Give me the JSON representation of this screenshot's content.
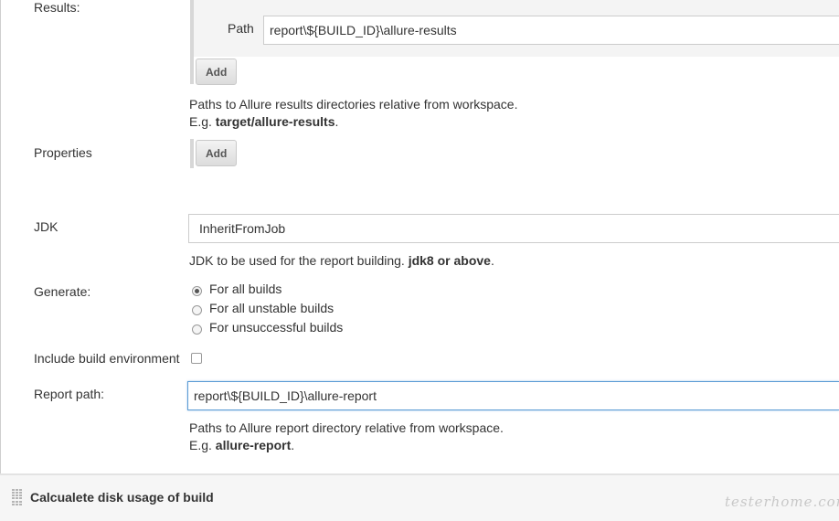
{
  "results": {
    "label": "Results:",
    "path_label": "Path",
    "path_value": "report\\${BUILD_ID}\\allure-results",
    "add_button": "Add",
    "help_line1": "Paths to Allure results directories relative from workspace.",
    "help_line2_prefix": "E.g. ",
    "help_line2_bold": "target/allure-results",
    "help_line2_suffix": "."
  },
  "properties": {
    "label": "Properties",
    "add_button": "Add"
  },
  "jdk": {
    "label": "JDK",
    "value": "InheritFromJob",
    "help_prefix": "JDK to be used for the report building. ",
    "help_bold": "jdk8 or above",
    "help_suffix": "."
  },
  "generate": {
    "label": "Generate:",
    "options": [
      {
        "label": "For all builds",
        "checked": true
      },
      {
        "label": "For all unstable builds",
        "checked": false
      },
      {
        "label": "For unsuccessful builds",
        "checked": false
      }
    ]
  },
  "include_env": {
    "label": "Include build environment",
    "checked": false
  },
  "report_path": {
    "label": "Report path:",
    "value": "report\\${BUILD_ID}\\allure-report",
    "help_line1": "Paths to Allure report directory relative from workspace.",
    "help_line2_prefix": "E.g. ",
    "help_line2_bold": "allure-report",
    "help_line2_suffix": "."
  },
  "next_section": {
    "title": "Calcualete disk usage of build"
  },
  "watermark": "testerhome.com",
  "colors": {
    "focus_border": "#5b9bd5",
    "panel_bg": "#f4f4f4",
    "section_bg": "#f6f6f6"
  }
}
